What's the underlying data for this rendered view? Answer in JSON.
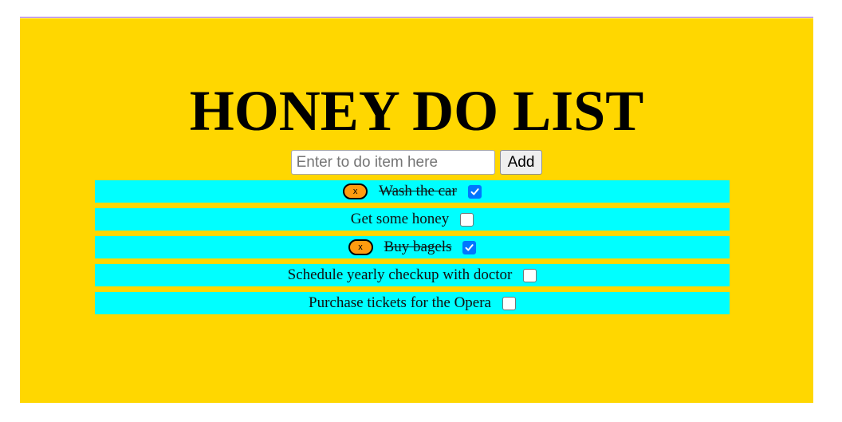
{
  "header": {
    "title": "HONEY DO LIST"
  },
  "form": {
    "input_placeholder": "Enter to do item here",
    "input_value": "",
    "add_label": "Add"
  },
  "todos": [
    {
      "text": "Wash the car",
      "done": true,
      "remove_label": "x"
    },
    {
      "text": "Get some honey",
      "done": false
    },
    {
      "text": "Buy bagels",
      "done": true,
      "remove_label": "x"
    },
    {
      "text": "Schedule yearly checkup with doctor",
      "done": false
    },
    {
      "text": "Purchase tickets for the Opera",
      "done": false
    }
  ],
  "colors": {
    "panel": "#ffd700",
    "item": "#00ffff",
    "remove_button": "#ff9b0f",
    "checkbox_checked": "#0075ff"
  }
}
